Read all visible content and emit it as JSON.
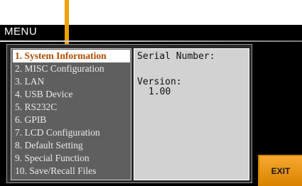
{
  "window": {
    "title": "MENU"
  },
  "menu": {
    "items": [
      {
        "label": "1. System Information",
        "selected": true
      },
      {
        "label": "2. MISC Configuration"
      },
      {
        "label": "3. LAN"
      },
      {
        "label": "4. USB Device"
      },
      {
        "label": "5. RS232C"
      },
      {
        "label": "6. GPIB"
      },
      {
        "label": "7. LCD Configuration"
      },
      {
        "label": "8. Default Setting"
      },
      {
        "label": "9. Special Function"
      },
      {
        "label": "10. Save/Recall Files"
      }
    ]
  },
  "info": {
    "serial_label": "Serial Number:",
    "version_label": "Version:",
    "version_value": "1.00"
  },
  "softkeys": {
    "exit_label": "EXIT"
  },
  "colors": {
    "accent": "#f0a000",
    "selected_text": "#b04a00",
    "panel": "#5f5f5f",
    "info_bg": "#d2d2d2"
  }
}
